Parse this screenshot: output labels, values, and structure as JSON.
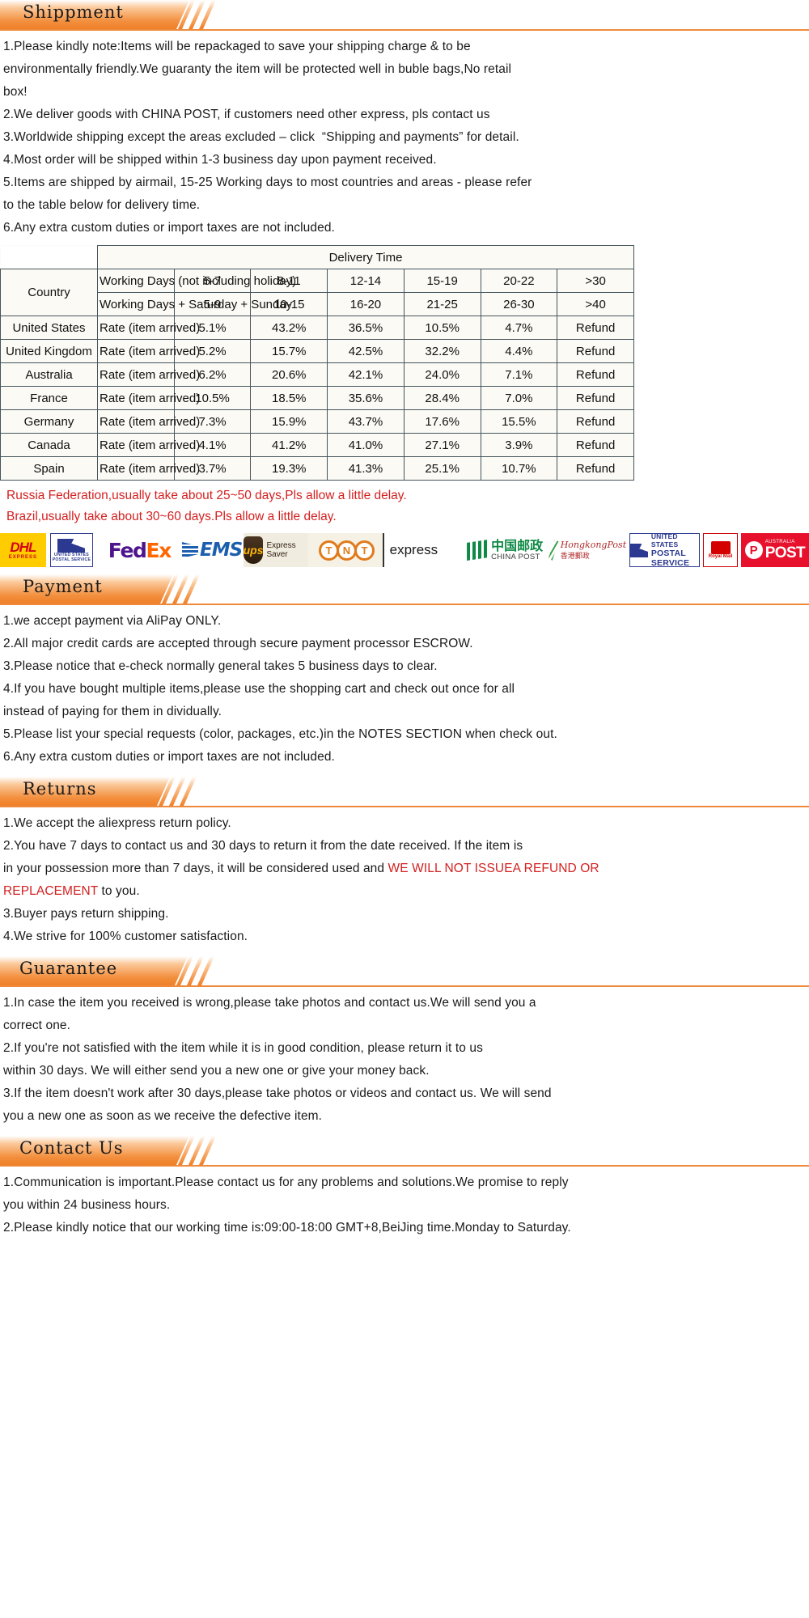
{
  "sections": {
    "shipment": {
      "title": "Shippment",
      "lines": [
        "1.Please kindly note:Items will be repackaged to save your shipping charge & to be",
        "environmentally friendly.We guaranty the item will be protected well in buble bags,No retail",
        "box!",
        "2.We deliver goods with CHINA POST, if customers need other express, pls contact us",
        "3.Worldwide shipping except the areas excluded – click  “Shipping and payments” for detail.",
        "4.Most order will be shipped within 1-3 business day upon payment received.",
        "5.Items are shipped by airmail, 15-25 Working days to most countries and areas - please refer",
        "to the table below for delivery time.",
        "6.Any extra custom duties or import taxes are not included."
      ]
    },
    "payment": {
      "title": "Payment",
      "lines": [
        "1.we accept payment via AliPay ONLY.",
        "2.All major credit cards are accepted through secure payment processor ESCROW.",
        "3.Please notice that e-check normally general takes 5 business days to clear.",
        "4.If you have bought multiple items,please use the shopping cart and check out once for all",
        "instead of paying for them in dividually.",
        "5.Please list your special requests (color, packages, etc.)in the NOTES SECTION when check out.",
        "6.Any extra custom duties or import taxes are not included."
      ]
    },
    "returns": {
      "title": "Returns",
      "line1": "1.We accept the aliexpress return policy.",
      "line2": "2.You have 7 days to contact us and 30 days to return it from the date received. If the item is",
      "line3a": "in your possession more than 7 days, it will be considered used and ",
      "line3_red1": "WE WILL NOT ISSUEA REFUND OR",
      "line4_red2": "REPLACEMENT",
      "line4b": " to you.",
      "line5": "3.Buyer pays return shipping.",
      "line6": "4.We strive for 100% customer satisfaction."
    },
    "guarantee": {
      "title": "Guarantee",
      "lines": [
        "1.In case the item you received is wrong,please take photos and contact us.We will send you a",
        "correct one.",
        "2.If you're not satisfied with the item while it is in good condition, please return it to us",
        "within 30 days. We will either send you a new one or give your money back.",
        "3.If the item doesn't work after 30 days,please take photos or videos and contact us. We will send",
        "you a new one as soon as we receive the defective item."
      ]
    },
    "contact": {
      "title": "Contact Us",
      "lines": [
        "1.Communication is important.Please contact us for any problems and solutions.We promise to reply",
        "you within 24 business hours.",
        "2.Please kindly notice that our working time is:09:00-18:00 GMT+8,BeiJing time.Monday to Saturday."
      ]
    }
  },
  "chart_data": {
    "type": "table",
    "title": "Delivery Time",
    "country_header": "Country",
    "row_headers": [
      "Working Days (not including holiday)",
      "Working Days + Saturday + Sunday"
    ],
    "categories": [
      "5-7",
      "8-11",
      "12-14",
      "15-19",
      "20-22",
      ">30"
    ],
    "categories_weekend": [
      "5-9",
      "10-15",
      "16-20",
      "21-25",
      "26-30",
      ">40"
    ],
    "rate_label": "Rate (item arrived)",
    "rows": [
      {
        "country": "United States",
        "values": [
          "5.1%",
          "43.2%",
          "36.5%",
          "10.5%",
          "4.7%",
          "Refund"
        ]
      },
      {
        "country": "United Kingdom",
        "values": [
          "5.2%",
          "15.7%",
          "42.5%",
          "32.2%",
          "4.4%",
          "Refund"
        ]
      },
      {
        "country": "Australia",
        "values": [
          "6.2%",
          "20.6%",
          "42.1%",
          "24.0%",
          "7.1%",
          "Refund"
        ]
      },
      {
        "country": "France",
        "values": [
          "10.5%",
          "18.5%",
          "35.6%",
          "28.4%",
          "7.0%",
          "Refund"
        ]
      },
      {
        "country": "Germany",
        "values": [
          "7.3%",
          "15.9%",
          "43.7%",
          "17.6%",
          "15.5%",
          "Refund"
        ]
      },
      {
        "country": "Canada",
        "values": [
          "4.1%",
          "41.2%",
          "41.0%",
          "27.1%",
          "3.9%",
          "Refund"
        ]
      },
      {
        "country": "Spain",
        "values": [
          "3.7%",
          "19.3%",
          "41.3%",
          "25.1%",
          "10.7%",
          "Refund"
        ]
      }
    ]
  },
  "red_notes": [
    "Russia Federation,usually take about 25~50 days,Pls allow a little delay.",
    "Brazil,usually take about 30~60 days.Pls allow a little delay."
  ],
  "carriers": {
    "dhl_name": "DHL",
    "dhl_sub": "EXPRESS",
    "usps1_l1": "UNITED STATES",
    "usps1_l2": "POSTAL SERVICE",
    "fedex_a": "Fed",
    "fedex_b": "Ex",
    "ems": "EMS",
    "ups_mark": "ups",
    "ups_sub": "Express Saver",
    "tnt_t": "T",
    "tnt_n": "N",
    "tnt_t2": "T",
    "express": "express",
    "chinapost_cn": "中国邮政",
    "chinapost_en": "CHINA POST",
    "hk_en": "HongkongPost",
    "hk_cn": "香港郵政",
    "usps2_l1": "UNITED STATES",
    "usps2_l2": "POSTAL SERVICE",
    "royal": "Royal Mail",
    "au_l1": "AUSTRALIA",
    "au_l2": "POST"
  },
  "colors": {
    "accent": "#ef8a3c",
    "red": "#d42020",
    "table_border": "#46545c"
  }
}
